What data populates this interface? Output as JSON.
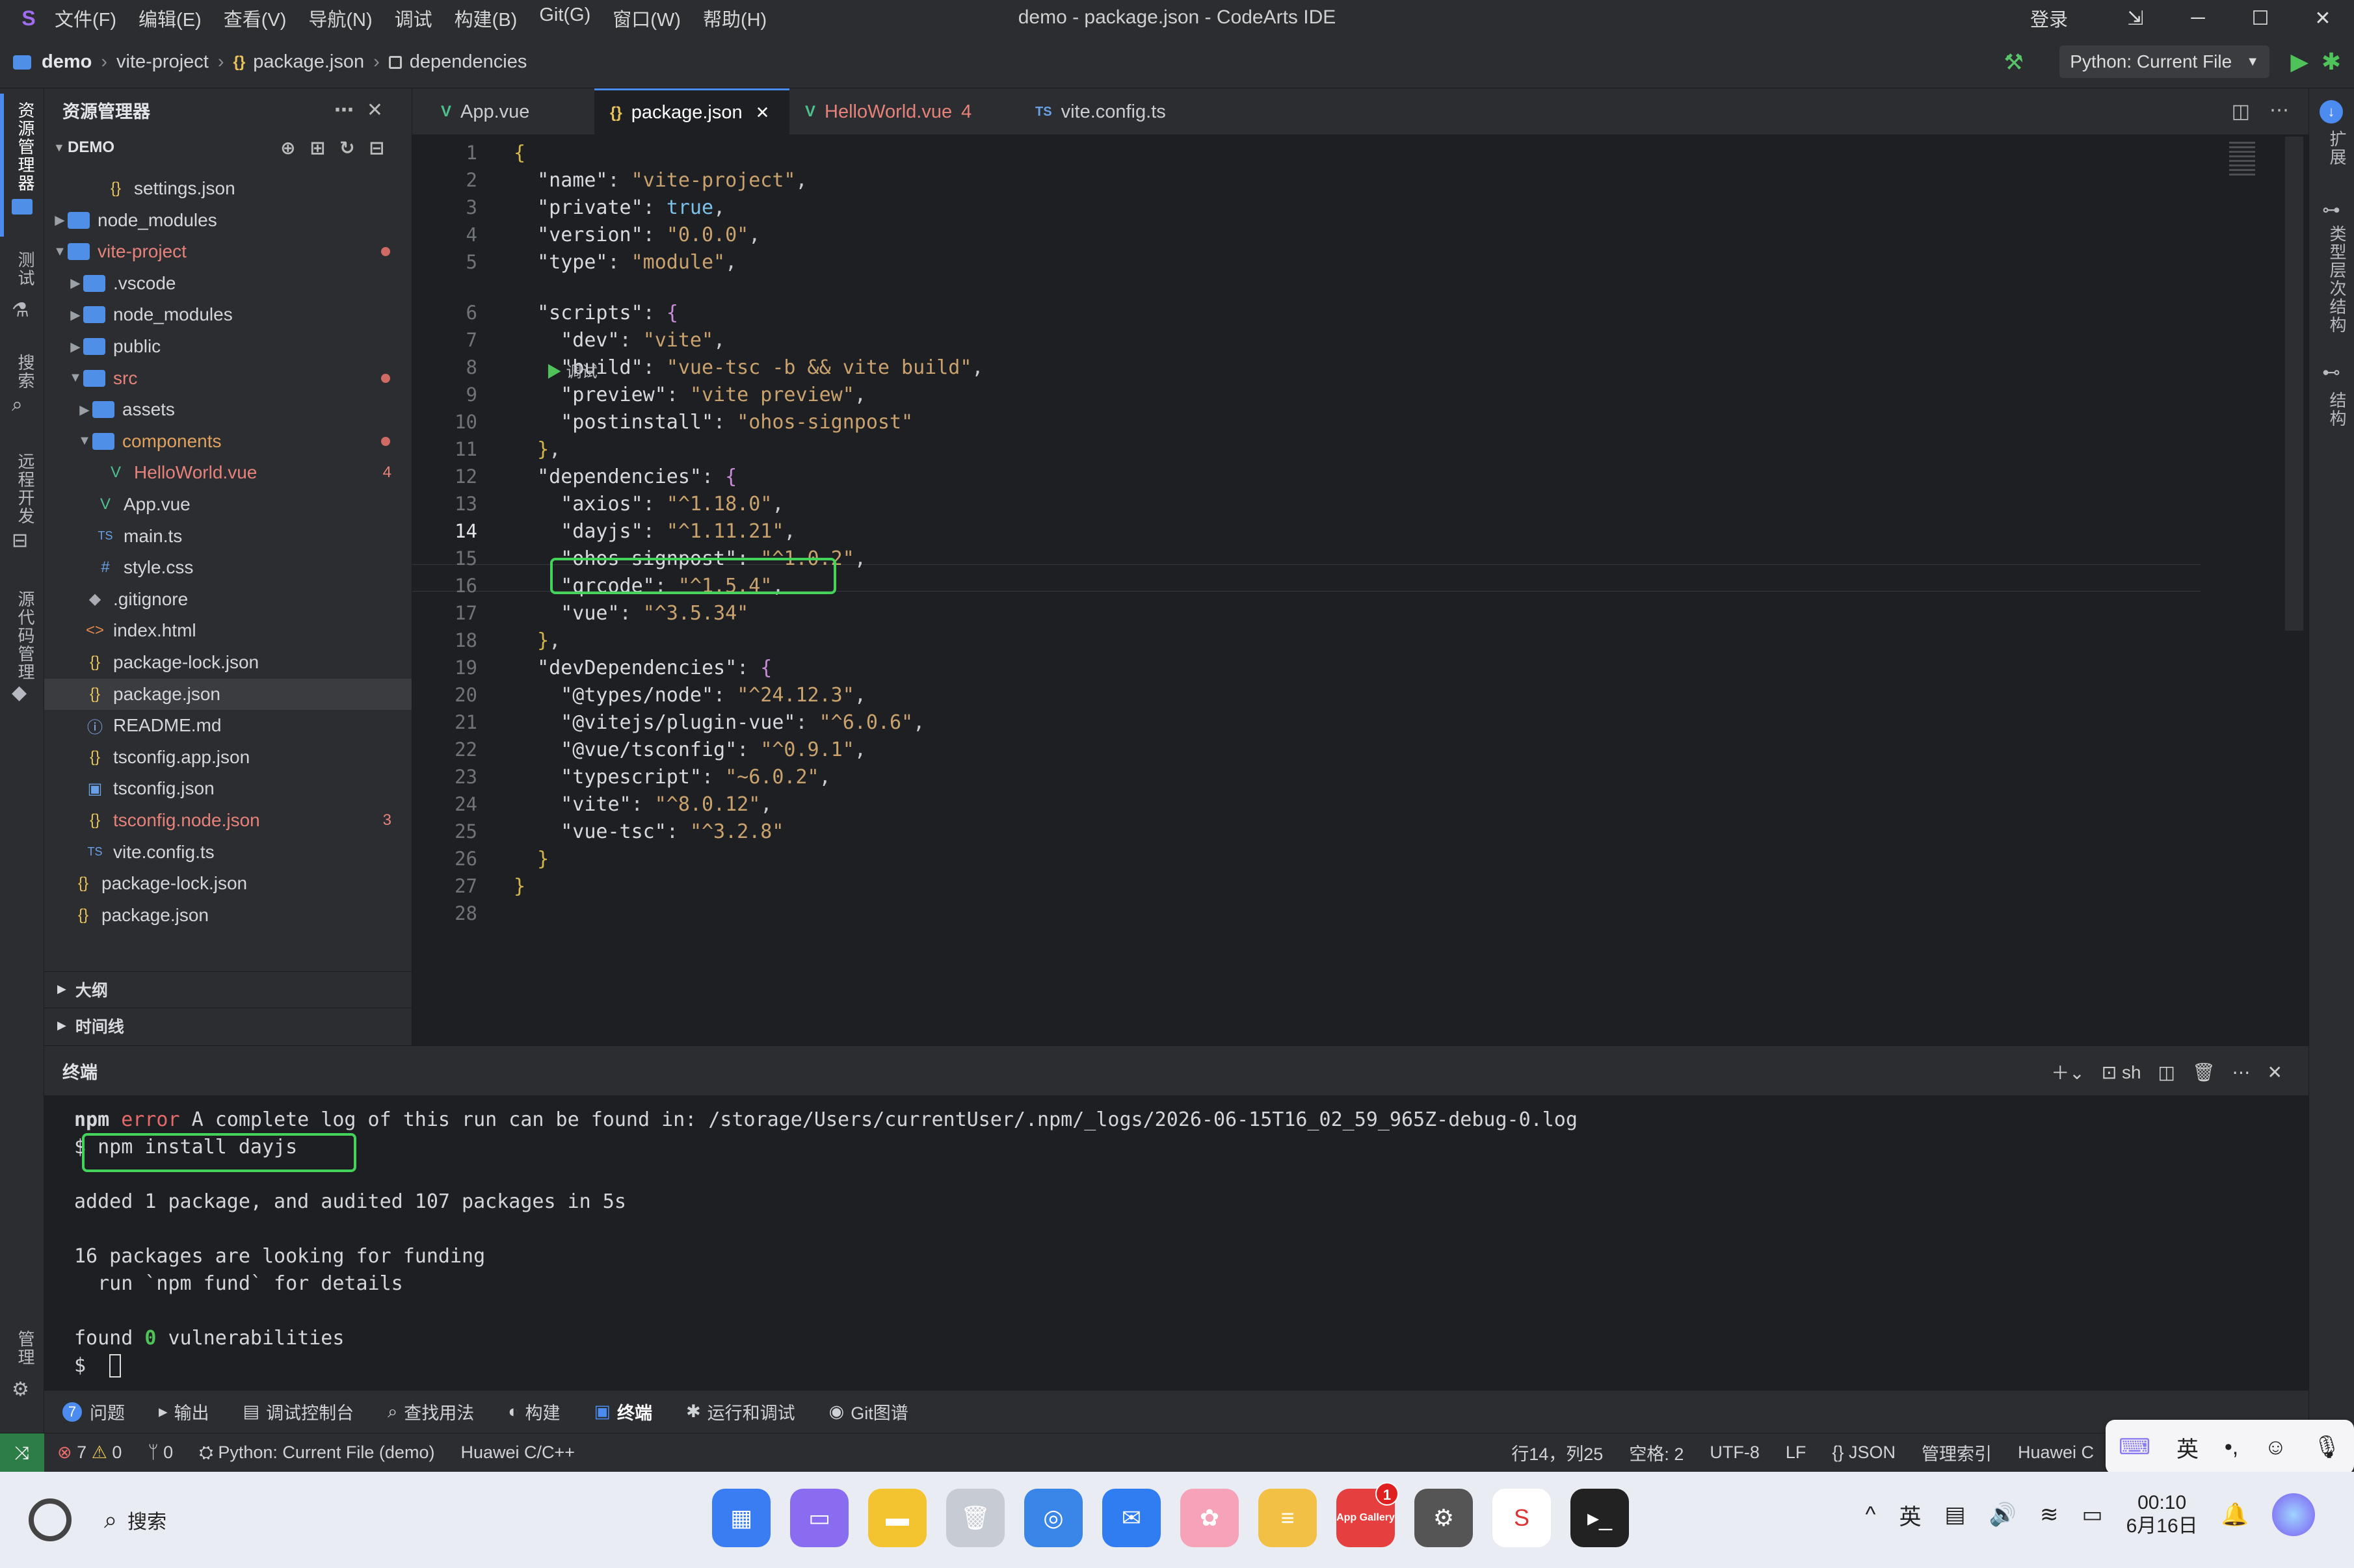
{
  "titlebar": {
    "menus": [
      "文件(F)",
      "编辑(E)",
      "查看(V)",
      "导航(N)",
      "调试",
      "构建(B)",
      "Git(G)",
      "窗口(W)",
      "帮助(H)"
    ],
    "title": "demo - package.json - CodeArts IDE",
    "login": "登录"
  },
  "breadcrumb": {
    "project": "demo",
    "folder": "vite-project",
    "file": "package.json",
    "symbol": "dependencies",
    "run_config": "Python: Current File"
  },
  "activity": {
    "explorer": "资源管理器",
    "test": "测试",
    "search": "搜索",
    "remote": "远程开发",
    "scm": "源代码管理",
    "manage": "管理",
    "right_ext": "扩展",
    "right_class": "类型层次结构",
    "right_struct": "结构"
  },
  "sidebar": {
    "title": "资源管理器",
    "root": "DEMO",
    "tree": [
      {
        "label": "settings.json",
        "icon": "json-icon"
      },
      {
        "label": "node_modules",
        "icon": "folder-icon"
      },
      {
        "label": "vite-project",
        "icon": "folder-icon"
      },
      {
        "label": ".vscode",
        "icon": "folder-icon"
      },
      {
        "label": "node_modules",
        "icon": "folder-icon"
      },
      {
        "label": "public",
        "icon": "folder-icon"
      },
      {
        "label": "src",
        "icon": "folder-icon"
      },
      {
        "label": "assets",
        "icon": "folder-icon"
      },
      {
        "label": "components",
        "icon": "folder-icon"
      },
      {
        "label": "HelloWorld.vue",
        "icon": "vue-icon",
        "badge": "4"
      },
      {
        "label": "App.vue",
        "icon": "vue-icon"
      },
      {
        "label": "main.ts",
        "icon": "ts-icon"
      },
      {
        "label": "style.css",
        "icon": "css-icon"
      },
      {
        "label": ".gitignore",
        "icon": "git-icon"
      },
      {
        "label": "index.html",
        "icon": "html-icon"
      },
      {
        "label": "package-lock.json",
        "icon": "json-icon"
      },
      {
        "label": "package.json",
        "icon": "json-icon"
      },
      {
        "label": "README.md",
        "icon": "info-icon"
      },
      {
        "label": "tsconfig.app.json",
        "icon": "json-icon"
      },
      {
        "label": "tsconfig.json",
        "icon": "tsconfig-icon"
      },
      {
        "label": "tsconfig.node.json",
        "icon": "json-icon",
        "badge": "3"
      },
      {
        "label": "vite.config.ts",
        "icon": "ts-icon"
      },
      {
        "label": "package-lock.json",
        "icon": "json-icon"
      },
      {
        "label": "package.json",
        "icon": "json-icon"
      }
    ],
    "outline": "大纲",
    "timeline": "时间线"
  },
  "tabs": [
    {
      "label": "App.vue",
      "icon": "V"
    },
    {
      "label": "package.json",
      "icon": "{}"
    },
    {
      "label": "HelloWorld.vue",
      "icon": "V",
      "badge": "4"
    },
    {
      "label": "vite.config.ts",
      "icon": "TS"
    }
  ],
  "code": {
    "debug_lens": "调试",
    "lines": [
      {
        "n": "1",
        "t": "{"
      },
      {
        "n": "2",
        "t": "  \"name\": \"vite-project\","
      },
      {
        "n": "3",
        "t": "  \"private\": true,"
      },
      {
        "n": "4",
        "t": "  \"version\": \"0.0.0\","
      },
      {
        "n": "5",
        "t": "  \"type\": \"module\","
      },
      {
        "n": "6",
        "t": "  \"scripts\": {"
      },
      {
        "n": "7",
        "t": "    \"dev\": \"vite\","
      },
      {
        "n": "8",
        "t": "    \"build\": \"vue-tsc -b && vite build\","
      },
      {
        "n": "9",
        "t": "    \"preview\": \"vite preview\","
      },
      {
        "n": "10",
        "t": "    \"postinstall\": \"ohos-signpost\""
      },
      {
        "n": "11",
        "t": "  },"
      },
      {
        "n": "12",
        "t": "  \"dependencies\": {"
      },
      {
        "n": "13",
        "t": "    \"axios\": \"^1.18.0\","
      },
      {
        "n": "14",
        "t": "    \"dayjs\": \"^1.11.21\","
      },
      {
        "n": "15",
        "t": "    \"ohos-signpost\": \"^1.0.2\","
      },
      {
        "n": "16",
        "t": "    \"qrcode\": \"^1.5.4\","
      },
      {
        "n": "17",
        "t": "    \"vue\": \"^3.5.34\""
      },
      {
        "n": "18",
        "t": "  },"
      },
      {
        "n": "19",
        "t": "  \"devDependencies\": {"
      },
      {
        "n": "20",
        "t": "    \"@types/node\": \"^24.12.3\","
      },
      {
        "n": "21",
        "t": "    \"@vitejs/plugin-vue\": \"^6.0.6\","
      },
      {
        "n": "22",
        "t": "    \"@vue/tsconfig\": \"^0.9.1\","
      },
      {
        "n": "23",
        "t": "    \"typescript\": \"~6.0.2\","
      },
      {
        "n": "24",
        "t": "    \"vite\": \"^8.0.12\","
      },
      {
        "n": "25",
        "t": "    \"vue-tsc\": \"^3.2.8\""
      },
      {
        "n": "26",
        "t": "  }"
      },
      {
        "n": "27",
        "t": "}"
      },
      {
        "n": "28",
        "t": ""
      }
    ]
  },
  "terminal": {
    "title": "终端",
    "shell": "sh",
    "lines": [
      "npm error A complete log of this run can be found in: /storage/Users/currentUser/.npm/_logs/2026-06-15T16_02_59_965Z-debug-0.log",
      "$ npm install dayjs",
      "",
      "added 1 package, and audited 107 packages in 5s",
      "",
      "16 packages are looking for funding",
      "  run `npm fund` for details",
      "",
      "found 0 vulnerabilities",
      "$ "
    ]
  },
  "panel_tabs": [
    {
      "label": "问题",
      "count": "7"
    },
    {
      "label": "输出"
    },
    {
      "label": "调试控制台"
    },
    {
      "label": "查找用法"
    },
    {
      "label": "构建"
    },
    {
      "label": "终端"
    },
    {
      "label": "运行和调试"
    },
    {
      "label": "Git图谱"
    }
  ],
  "status": {
    "errors": "7",
    "warnings": "0",
    "ports": "0",
    "run": "Python: Current File (demo)",
    "lang_left": "Huawei C/C++",
    "position": "行14，列25",
    "spaces": "空格: 2",
    "encoding": "UTF-8",
    "eol": "LF",
    "mode": "JSON",
    "index": "管理索引",
    "lang_right": "Huawei C"
  },
  "ime": {
    "lang": "英"
  },
  "taskbar": {
    "search": "搜索",
    "app_gallery": "App Gallery",
    "notif": "1",
    "time": "00:10",
    "date": "6月16日",
    "tray_lang": "英"
  }
}
